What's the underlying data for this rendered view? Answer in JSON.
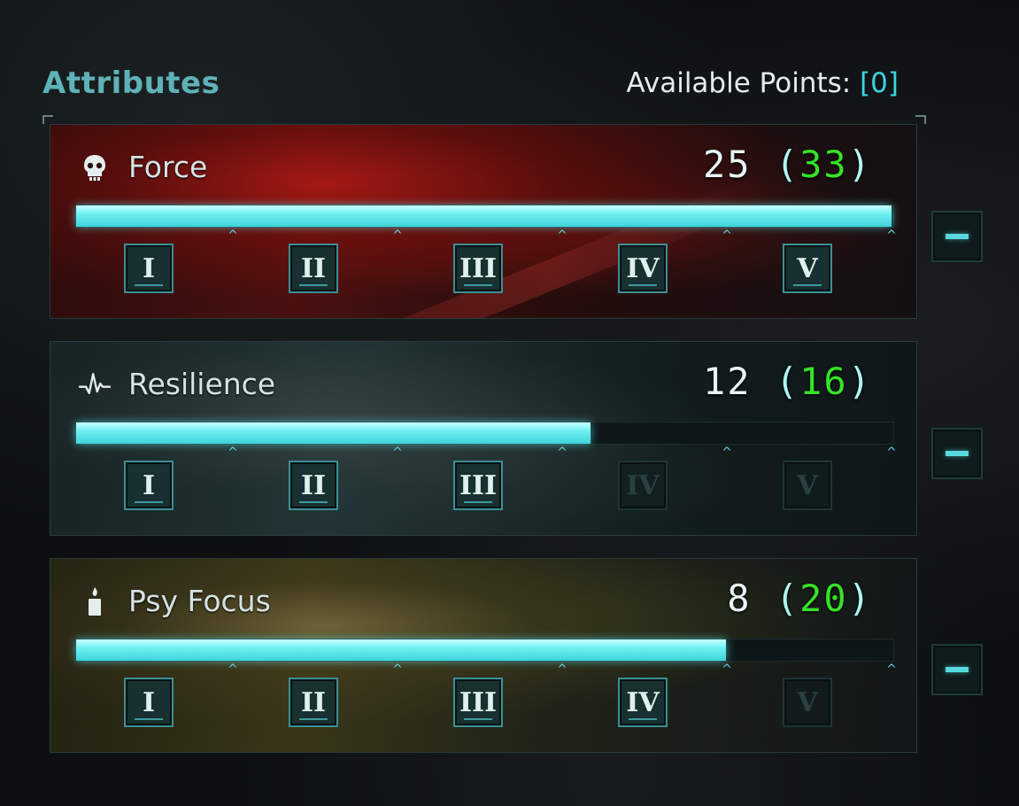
{
  "header": {
    "title": "Attributes",
    "available_points_label": "Available Points:",
    "available_points_value": "[0]"
  },
  "attributes": [
    {
      "name": "Force",
      "icon": "skull-icon",
      "value": "25",
      "bonus": "33",
      "bar_fill_fraction": 0.998,
      "tiers": [
        {
          "label": "I",
          "unlocked": true
        },
        {
          "label": "II",
          "unlocked": true
        },
        {
          "label": "III",
          "unlocked": true
        },
        {
          "label": "IV",
          "unlocked": true
        },
        {
          "label": "V",
          "unlocked": true
        }
      ]
    },
    {
      "name": "Resilience",
      "icon": "heartbeat-icon",
      "value": "12",
      "bonus": "16",
      "bar_fill_fraction": 0.63,
      "tiers": [
        {
          "label": "I",
          "unlocked": true
        },
        {
          "label": "II",
          "unlocked": true
        },
        {
          "label": "III",
          "unlocked": true
        },
        {
          "label": "IV",
          "unlocked": false
        },
        {
          "label": "V",
          "unlocked": false
        }
      ]
    },
    {
      "name": "Psy Focus",
      "icon": "candle-icon",
      "value": "8",
      "bonus": "20",
      "bar_fill_fraction": 0.795,
      "tiers": [
        {
          "label": "I",
          "unlocked": true
        },
        {
          "label": "II",
          "unlocked": true
        },
        {
          "label": "III",
          "unlocked": true
        },
        {
          "label": "IV",
          "unlocked": true
        },
        {
          "label": "V",
          "unlocked": false
        }
      ]
    }
  ],
  "colors": {
    "accent": "#3dd3df",
    "bonus": "#36e228",
    "title": "#5fb2b8"
  }
}
